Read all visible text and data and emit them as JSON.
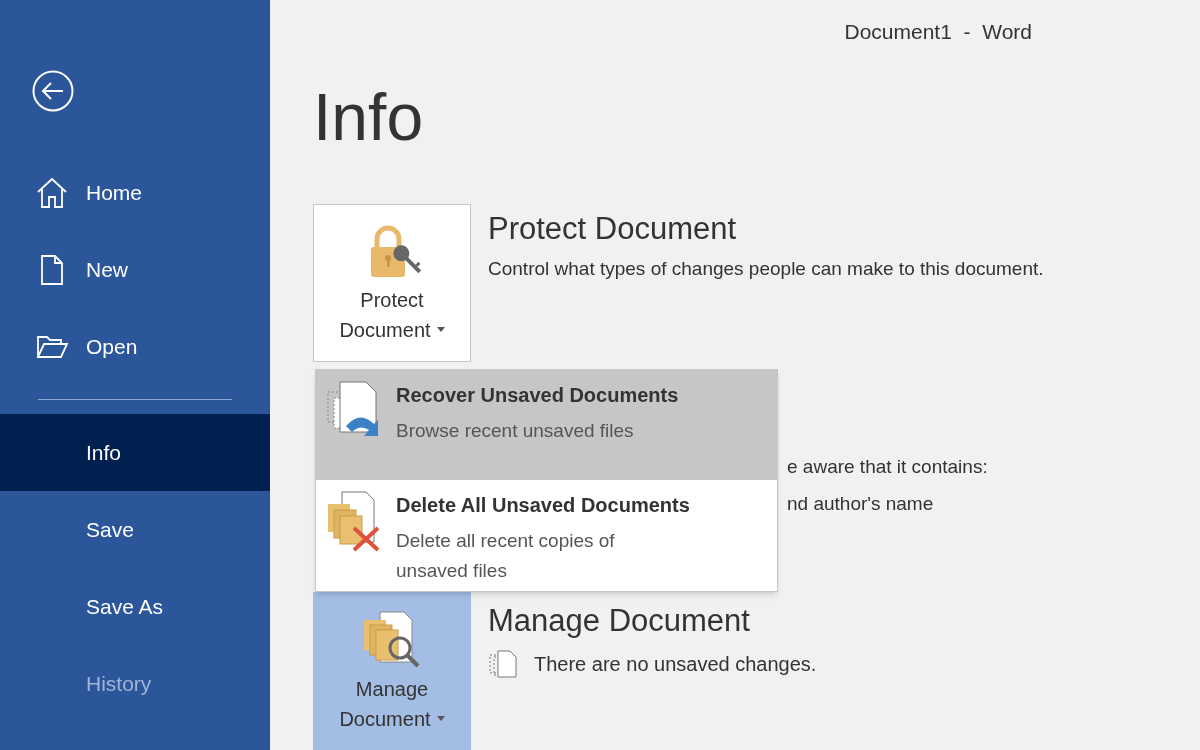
{
  "window": {
    "title": "Document1  -  Word"
  },
  "sidebar": {
    "items": [
      {
        "label": "Home",
        "kind": "home",
        "selected": false,
        "disabled": false
      },
      {
        "label": "New",
        "kind": "new",
        "selected": false,
        "disabled": false
      },
      {
        "label": "Open",
        "kind": "open",
        "selected": false,
        "disabled": false
      },
      {
        "kind": "divider"
      },
      {
        "label": "Info",
        "kind": "plain",
        "selected": true,
        "disabled": false
      },
      {
        "label": "Save",
        "kind": "plain",
        "selected": false,
        "disabled": false
      },
      {
        "label": "Save As",
        "kind": "plain",
        "selected": false,
        "disabled": false
      },
      {
        "label": "History",
        "kind": "plain",
        "selected": false,
        "disabled": true
      }
    ]
  },
  "page_title": "Info",
  "protect": {
    "button_lines": [
      "Protect",
      "Document"
    ],
    "highlighted": false,
    "heading": "Protect Document",
    "description": "Control what types of changes people can make to this document."
  },
  "inspect": {
    "lines": [
      "e aware that it contains:",
      "nd author's name"
    ]
  },
  "menu": {
    "items": [
      {
        "kind": "recover",
        "title": "Recover Unsaved Documents",
        "description": "Browse recent unsaved files",
        "highlighted": true
      },
      {
        "kind": "delete",
        "title": "Delete All Unsaved Documents",
        "description": "Delete all recent copies of unsaved files",
        "highlighted": false
      }
    ]
  },
  "manage": {
    "button_lines": [
      "Manage",
      "Document"
    ],
    "highlighted": true,
    "heading": "Manage Document",
    "status": "There are no unsaved changes."
  }
}
